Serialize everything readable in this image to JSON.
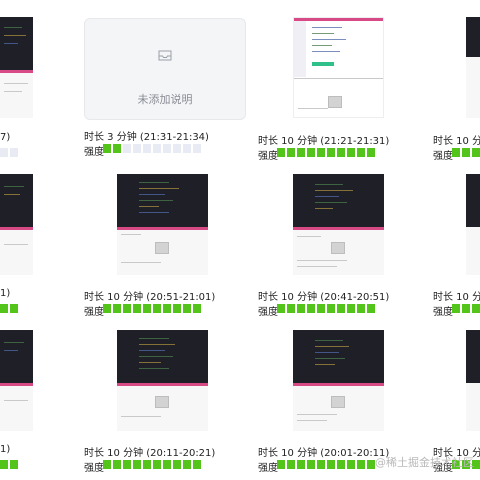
{
  "placeholder_card": {
    "text": "未添加说明",
    "icon": "inbox-icon"
  },
  "rows": [
    {
      "cells": [
        {
          "duration": "7)",
          "intensity_label": "",
          "level": 0.0
        },
        {
          "duration": "时长 3 分钟 (21:31-21:34)",
          "intensity_label": "强度",
          "level": 0.2
        },
        {
          "duration": "时长 10 分钟 (21:21-21:31)",
          "intensity_label": "强度",
          "level": 1.0
        },
        {
          "duration": "时长 10 分钟",
          "intensity_label": "强度",
          "level": 1.0
        }
      ]
    },
    {
      "cells": [
        {
          "duration": "1)",
          "intensity_label": "",
          "level": 1.0
        },
        {
          "duration": "时长 10 分钟 (20:51-21:01)",
          "intensity_label": "强度",
          "level": 1.0
        },
        {
          "duration": "时长 10 分钟 (20:41-20:51)",
          "intensity_label": "强度",
          "level": 1.0
        },
        {
          "duration": "时长 10 分钟",
          "intensity_label": "强度",
          "level": 1.0
        }
      ]
    },
    {
      "cells": [
        {
          "duration": "1)",
          "intensity_label": "",
          "level": 1.0
        },
        {
          "duration": "时长 10 分钟 (20:11-20:21)",
          "intensity_label": "强度",
          "level": 1.0
        },
        {
          "duration": "时长 10 分钟 (20:01-20:11)",
          "intensity_label": "强度",
          "level": 1.0
        },
        {
          "duration": "时长 10 分钟",
          "intensity_label": "强度",
          "level": 1.0
        }
      ]
    }
  ],
  "watermark": "@稀土掘金技术社区",
  "colors": {
    "bar_on": "#52c41a",
    "bar_off": "#e8ebf3",
    "editor_bg": "#1f2027"
  }
}
